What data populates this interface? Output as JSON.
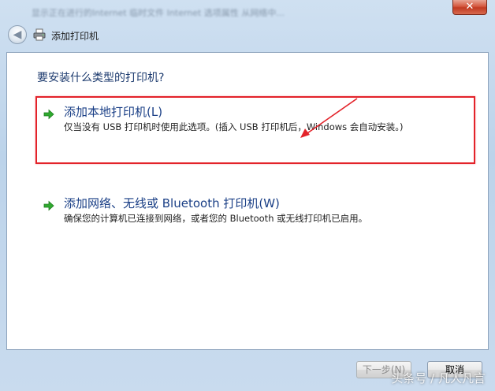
{
  "window": {
    "titlebar_text": "显示正在进行的Internet 临时文件 Internet 选项属性 从网络中...",
    "close_glyph": "✕",
    "back_glyph": "◀",
    "title": "添加打印机"
  },
  "main": {
    "question": "要安装什么类型的打印机?",
    "options": [
      {
        "title": "添加本地打印机(L)",
        "description": "仅当没有 USB 打印机时使用此选项。(插入 USB 打印机后，Windows 会自动安装。)",
        "icon": "green-arrow-icon"
      },
      {
        "title": "添加网络、无线或 Bluetooth 打印机(W)",
        "description": "确保您的计算机已连接到网络，或者您的 Bluetooth 或无线打印机已启用。",
        "icon": "green-arrow-icon"
      }
    ]
  },
  "footer": {
    "next_label": "下一步(N)",
    "cancel_label": "取消",
    "watermark": "头条号 / 凡人凡言"
  },
  "colors": {
    "highlight": "#e3232a",
    "option_title": "#1a3f86",
    "question": "#1c3a6e",
    "arrow_green": "#2faa2f"
  }
}
